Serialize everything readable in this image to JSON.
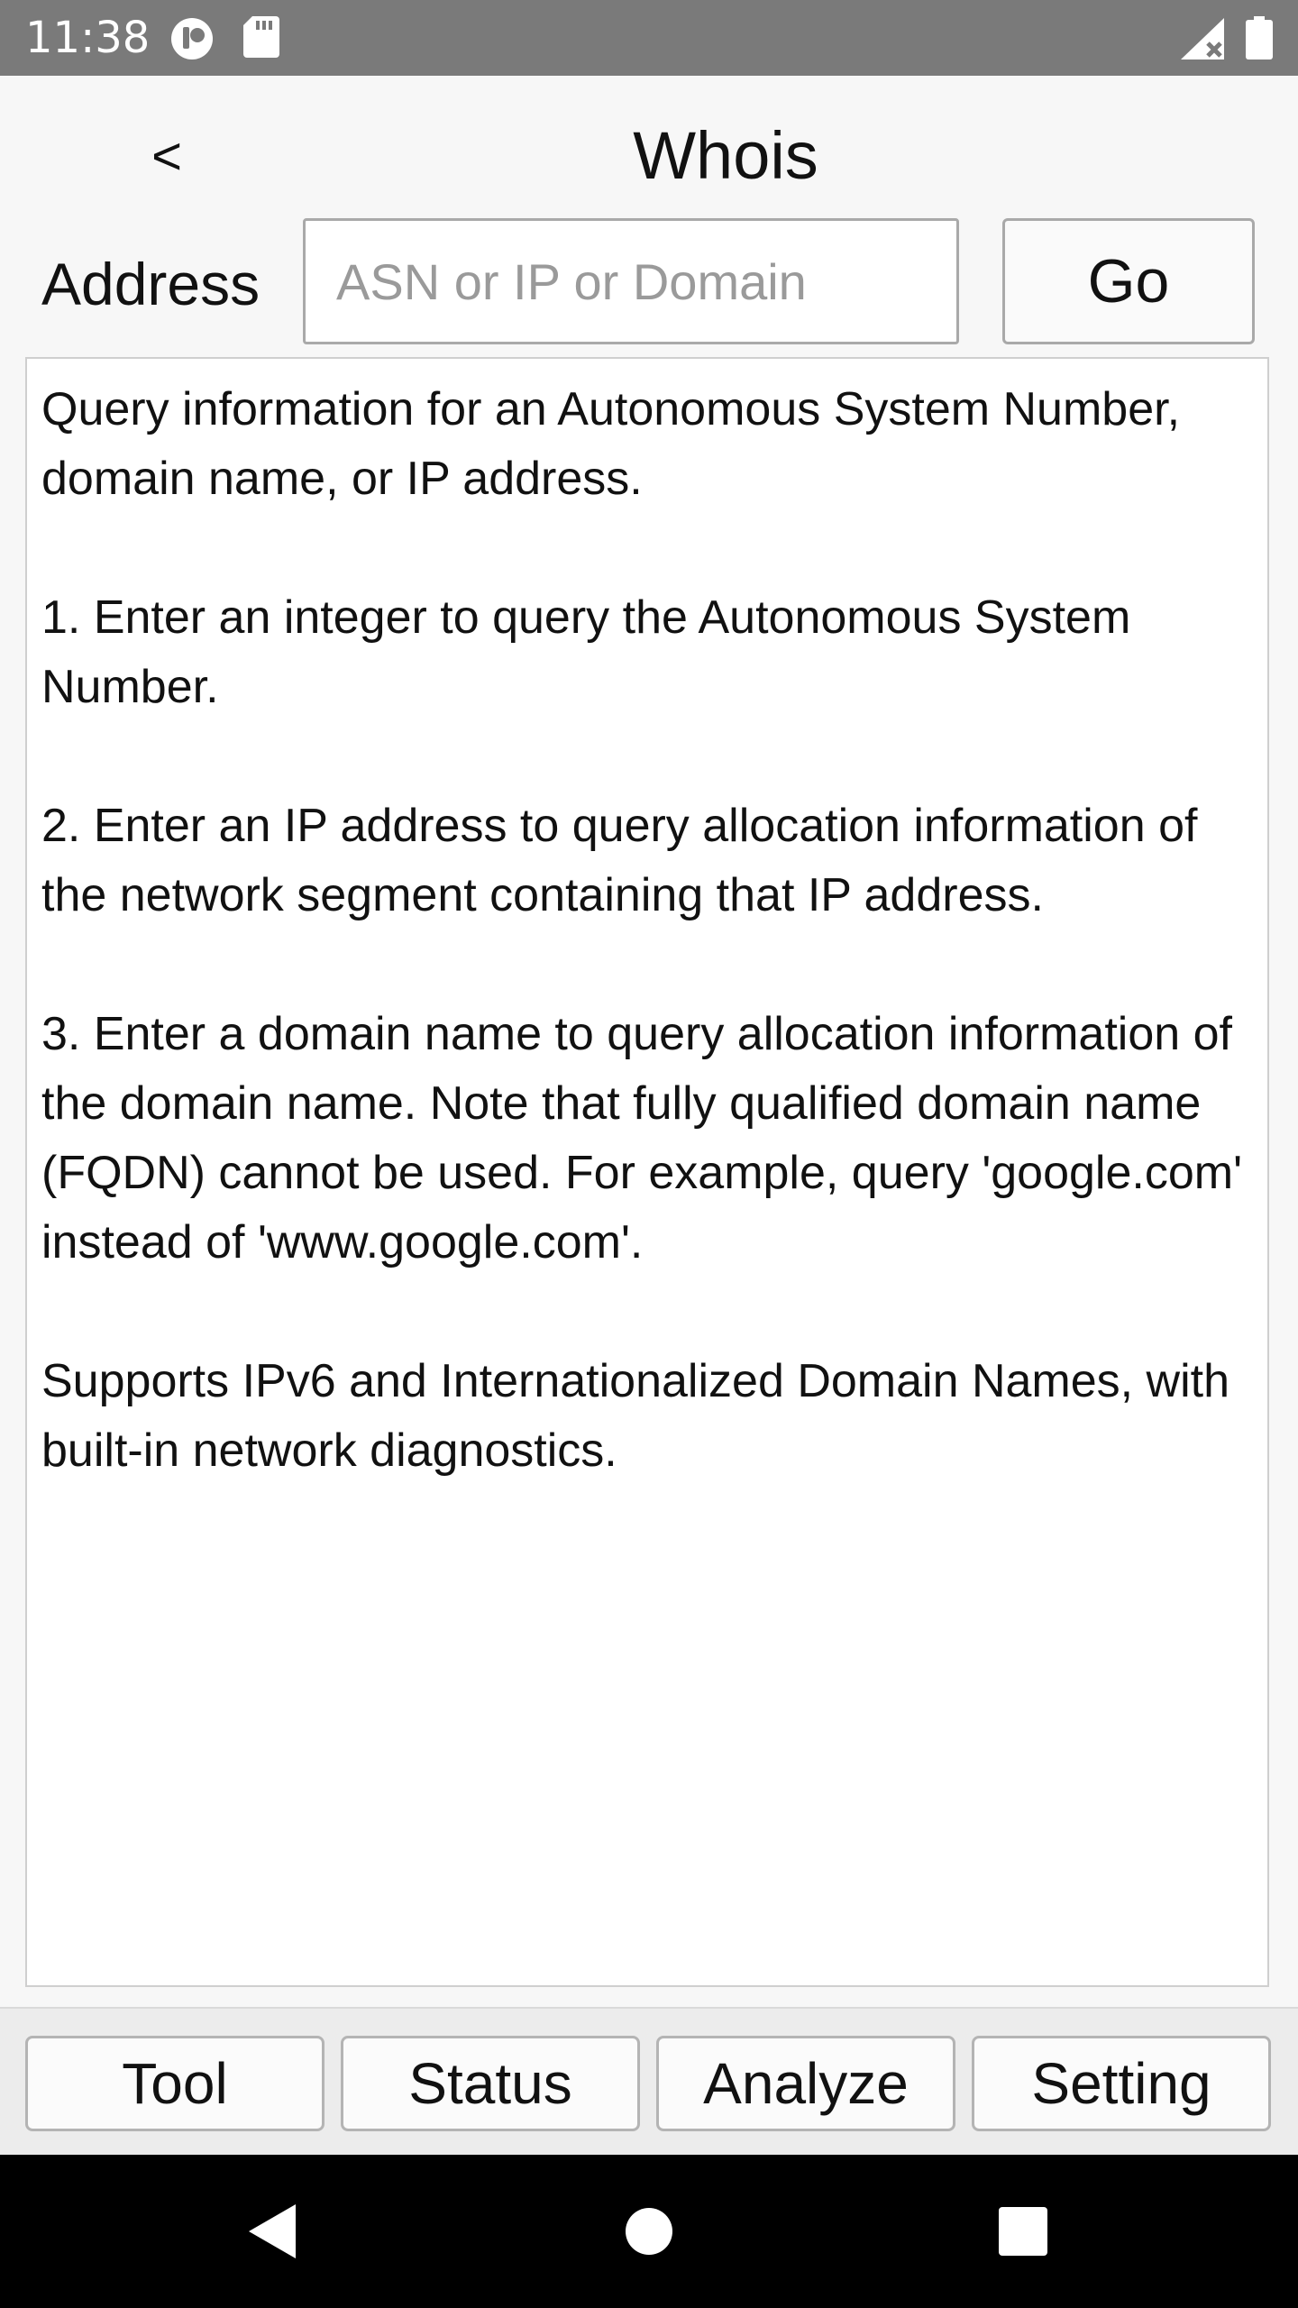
{
  "status_bar": {
    "time": "11:38",
    "icons": [
      "notification-icon",
      "sd-card-icon",
      "signal-icon",
      "battery-icon"
    ]
  },
  "header": {
    "back_label": "<",
    "title": "Whois"
  },
  "address": {
    "label": "Address",
    "value": "",
    "placeholder": "ASN or IP or Domain",
    "go_label": "Go"
  },
  "info_text": "Query information for an Autonomous System Number, domain name, or IP address.\n\n1. Enter an integer to query the Autonomous System Number.\n\n2. Enter an IP address to query allocation information of the network segment containing that IP address.\n\n3. Enter a domain name to query allocation information of the domain name. Note that fully qualified domain name (FQDN) cannot be used. For example, query 'google.com' instead of 'www.google.com'.\n\nSupports IPv6 and Internationalized Domain Names, with built-in network diagnostics.",
  "tabs": [
    {
      "label": "Tool"
    },
    {
      "label": "Status"
    },
    {
      "label": "Analyze"
    },
    {
      "label": "Setting"
    }
  ],
  "nav_bar": {
    "buttons": [
      "back-icon",
      "home-icon",
      "recents-icon"
    ]
  },
  "colors": {
    "status_bar": "#7a7a7a",
    "background": "#f7f7f7",
    "nav_bar": "#000000",
    "border": "#a9a9a9"
  }
}
